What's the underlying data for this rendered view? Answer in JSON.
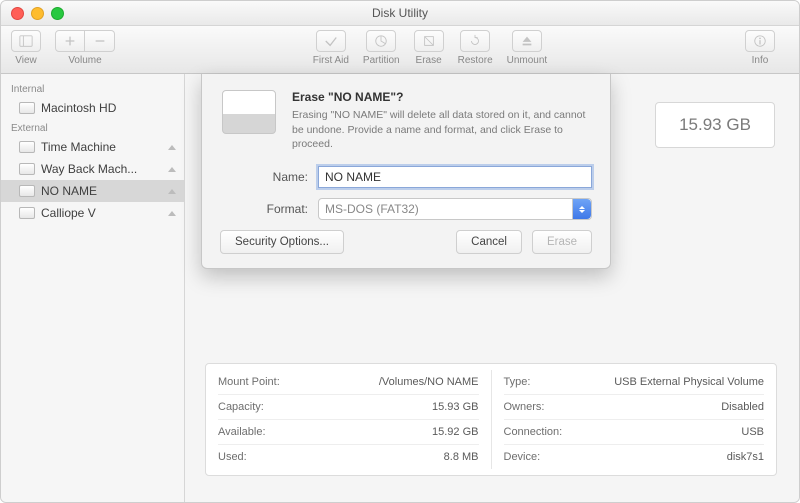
{
  "window": {
    "title": "Disk Utility"
  },
  "toolbar": {
    "view_label": "View",
    "volume_label": "Volume",
    "firstaid_label": "First Aid",
    "partition_label": "Partition",
    "erase_label": "Erase",
    "restore_label": "Restore",
    "unmount_label": "Unmount",
    "info_label": "Info"
  },
  "sidebar": {
    "internal_header": "Internal",
    "external_header": "External",
    "internal": [
      {
        "label": "Macintosh HD"
      }
    ],
    "external": [
      {
        "label": "Time Machine"
      },
      {
        "label": "Way Back Mach..."
      },
      {
        "label": "NO NAME"
      },
      {
        "label": "Calliope V"
      }
    ]
  },
  "summary": {
    "size": "15.93 GB"
  },
  "details": {
    "left": [
      {
        "k": "Mount Point:",
        "v": "/Volumes/NO NAME"
      },
      {
        "k": "Capacity:",
        "v": "15.93 GB"
      },
      {
        "k": "Available:",
        "v": "15.92 GB"
      },
      {
        "k": "Used:",
        "v": "8.8 MB"
      }
    ],
    "right": [
      {
        "k": "Type:",
        "v": "USB External Physical Volume"
      },
      {
        "k": "Owners:",
        "v": "Disabled"
      },
      {
        "k": "Connection:",
        "v": "USB"
      },
      {
        "k": "Device:",
        "v": "disk7s1"
      }
    ]
  },
  "sheet": {
    "title": "Erase \"NO NAME\"?",
    "description": "Erasing \"NO NAME\" will delete all data stored on it, and cannot be undone. Provide a name and format, and click Erase to proceed.",
    "name_label": "Name:",
    "name_value": "NO NAME",
    "format_label": "Format:",
    "format_value": "MS-DOS (FAT32)",
    "security_options": "Security Options...",
    "cancel": "Cancel",
    "erase": "Erase"
  }
}
